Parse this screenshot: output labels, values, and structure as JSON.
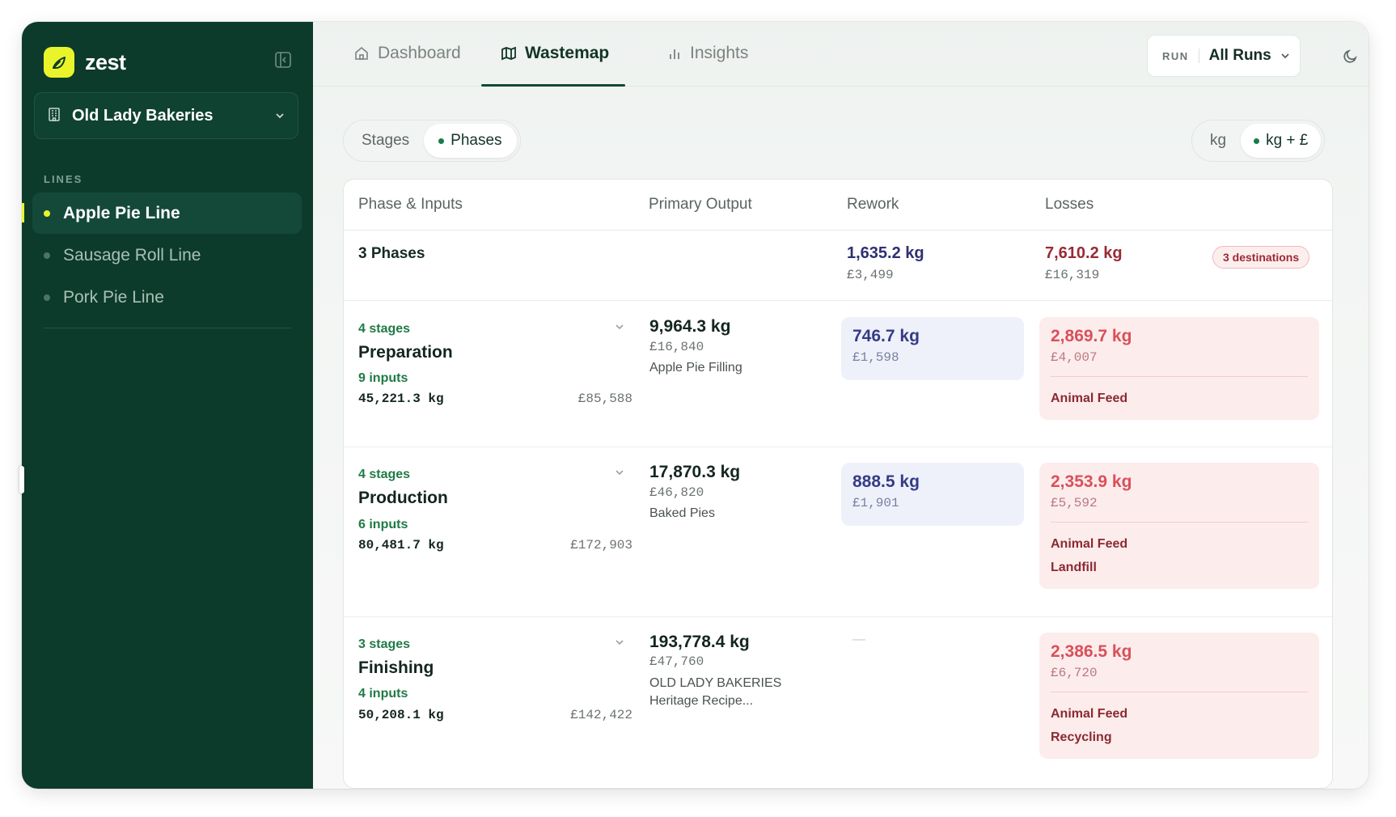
{
  "app": {
    "name": "zest"
  },
  "sidebar": {
    "org": "Old Lady Bakeries",
    "section_label": "LINES",
    "items": [
      {
        "label": "Apple Pie Line",
        "active": true
      },
      {
        "label": "Sausage Roll Line",
        "active": false
      },
      {
        "label": "Pork Pie Line",
        "active": false
      }
    ]
  },
  "topbar": {
    "tabs": [
      {
        "label": "Dashboard",
        "icon": "home-icon",
        "active": false
      },
      {
        "label": "Wastemap",
        "icon": "map-icon",
        "active": true
      },
      {
        "label": "Insights",
        "icon": "bar-chart-icon",
        "active": false
      }
    ],
    "run_label": "RUN",
    "run_value": "All Runs"
  },
  "view_toggle": {
    "options": [
      "Stages",
      "Phases"
    ],
    "selected": "Phases"
  },
  "unit_toggle": {
    "options": [
      "kg",
      "kg + £"
    ],
    "selected": "kg + £"
  },
  "table": {
    "headers": [
      "Phase & Inputs",
      "Primary Output",
      "Rework",
      "Losses"
    ],
    "summary": {
      "title": "3 Phases",
      "rework_kg": "1,635.2 kg",
      "rework_money": "£3,499",
      "losses_kg": "7,610.2 kg",
      "losses_money": "£16,319",
      "destinations_badge": "3 destinations"
    },
    "rows": [
      {
        "stages": "4 stages",
        "name": "Preparation",
        "inputs": "9 inputs",
        "inputs_kg": "45,221.3 kg",
        "inputs_money": "£85,588",
        "output_kg": "9,964.3 kg",
        "output_money": "£16,840",
        "output_name": "Apple Pie Filling",
        "rework_kg": "746.7 kg",
        "rework_money": "£1,598",
        "loss_kg": "2,869.7 kg",
        "loss_money": "£4,007",
        "destinations": [
          "Animal Feed"
        ]
      },
      {
        "stages": "4 stages",
        "name": "Production",
        "inputs": "6 inputs",
        "inputs_kg": "80,481.7 kg",
        "inputs_money": "£172,903",
        "output_kg": "17,870.3 kg",
        "output_money": "£46,820",
        "output_name": "Baked Pies",
        "rework_kg": "888.5 kg",
        "rework_money": "£1,901",
        "loss_kg": "2,353.9 kg",
        "loss_money": "£5,592",
        "destinations": [
          "Animal Feed",
          "Landfill"
        ]
      },
      {
        "stages": "3 stages",
        "name": "Finishing",
        "inputs": "4 inputs",
        "inputs_kg": "50,208.1 kg",
        "inputs_money": "£142,422",
        "output_kg": "193,778.4 kg",
        "output_money": "£47,760",
        "output_name_line1": "OLD LADY BAKERIES",
        "output_name_line2": "Heritage Recipe...",
        "rework_empty": "—",
        "loss_kg": "2,386.5 kg",
        "loss_money": "£6,720",
        "destinations": [
          "Animal Feed",
          "Recycling"
        ]
      }
    ]
  },
  "colors": {
    "sidebar_bg": "#0d3b2b",
    "accent_yellow": "#e9f52a",
    "accent_green": "#1f7a46",
    "rework_blue": "#353c86",
    "loss_red": "#d9505a"
  }
}
